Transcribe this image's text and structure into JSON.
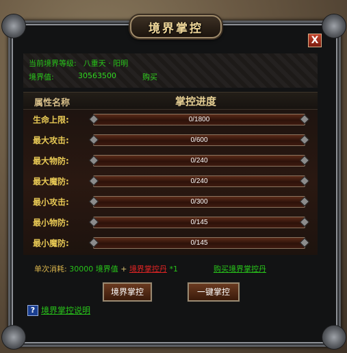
{
  "window": {
    "title": "境界掌控",
    "close_label": "X"
  },
  "info": {
    "level_label": "当前境界等级:",
    "level_value": "八重天 · 阳明",
    "value_label": "境界值:",
    "value_number": "30563500",
    "buy_label": "购买"
  },
  "header": {
    "name_col": "属性名称",
    "progress_col": "掌控进度"
  },
  "attributes": [
    {
      "label": "生命上限:",
      "progress": "0/1800",
      "fraction": 0
    },
    {
      "label": "最大攻击:",
      "progress": "0/600",
      "fraction": 0
    },
    {
      "label": "最大物防:",
      "progress": "0/240",
      "fraction": 0
    },
    {
      "label": "最大魔防:",
      "progress": "0/240",
      "fraction": 0
    },
    {
      "label": "最小攻击:",
      "progress": "0/300",
      "fraction": 0
    },
    {
      "label": "最小物防:",
      "progress": "0/145",
      "fraction": 0
    },
    {
      "label": "最小魔防:",
      "progress": "0/145",
      "fraction": 0
    }
  ],
  "cost": {
    "label": "单次消耗:",
    "amount": "30000",
    "unit": "境界值",
    "plus": "+",
    "item": "境界掌控丹",
    "multiplier": "*1",
    "buy_item": "购买境界掌控丹"
  },
  "buttons": {
    "control": "境界掌控",
    "one_click": "一键掌控"
  },
  "help": {
    "icon": "?",
    "link": "境界掌控说明"
  },
  "colors": {
    "accent_green": "#28c41a",
    "label_gold": "#e9ca55",
    "warning_red": "#e02424"
  }
}
